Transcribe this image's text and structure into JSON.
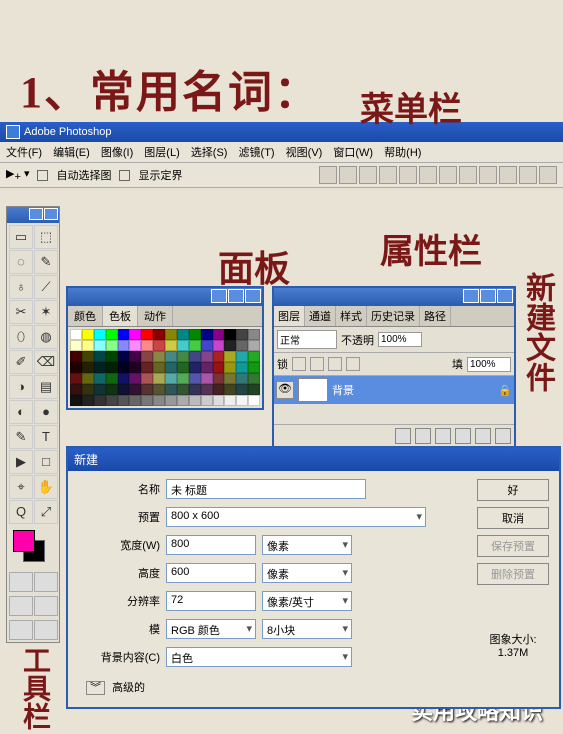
{
  "annotations": {
    "title": "1、常用名词：",
    "menubar": "菜单栏",
    "panel": "面板",
    "attrbar": "属性栏",
    "newfile": "新建文件",
    "toolbox": "工具栏",
    "watermark": "实用攻略知识"
  },
  "app": {
    "title": "Adobe Photoshop",
    "menu": {
      "file": "文件(F)",
      "edit": "编辑(E)",
      "image": "图像(I)",
      "layer": "图层(L)",
      "select": "选择(S)",
      "filter": "滤镜(T)",
      "view": "视图(V)",
      "window": "窗口(W)",
      "help": "帮助(H)"
    },
    "options": {
      "auto_select": "自动选择图",
      "show_bounds": "显示定界"
    }
  },
  "swatch_panel": {
    "tabs": {
      "color": "颜色",
      "swatches": "色板",
      "actions": "动作"
    }
  },
  "layers_panel": {
    "tabs": {
      "layers": "图层",
      "channels": "通道",
      "styles": "样式",
      "history": "历史记录",
      "paths": "路径"
    },
    "blend": "正常",
    "opacity_label": "不透明",
    "opacity": "100%",
    "lock_label": "锁",
    "fill_label": "填",
    "fill": "100%",
    "bg_layer": "背景"
  },
  "new_dialog": {
    "title": "新建",
    "name_label": "名称",
    "name": "未 标题",
    "preset_label": "预置",
    "preset": "800 x 600",
    "width_label": "宽度(W)",
    "width": "800",
    "width_unit": "像素",
    "height_label": "高度",
    "height": "600",
    "height_unit": "像素",
    "res_label": "分辨率",
    "res": "72",
    "res_unit": "像素/英寸",
    "mode_label": "模",
    "mode": "RGB 颜色",
    "depth": "8小块",
    "bg_label": "背景内容(C)",
    "bg": "白色",
    "advanced": "高级的",
    "ok": "好",
    "cancel": "取消",
    "save_preset": "保存预置",
    "del_preset": "删除预置",
    "size_label": "图象大小:",
    "size": "1.37M"
  },
  "tools": [
    "▭",
    "⬚",
    "◌",
    "✎",
    "♁",
    "⟋",
    "✂",
    "✶",
    "⬯",
    "◍",
    "✐",
    "⌫",
    "◑",
    "▤",
    "◐",
    "●",
    "✎",
    "T",
    "▶",
    "□",
    "⌖",
    "✋",
    "Q",
    "⤢"
  ],
  "swatch_colors": [
    "#fff",
    "#ff0",
    "#0ff",
    "#0f0",
    "#00f",
    "#f0f",
    "#f00",
    "#800",
    "#880",
    "#088",
    "#080",
    "#008",
    "#808",
    "#000",
    "#444",
    "#888",
    "#ffc",
    "#ff8",
    "#8ff",
    "#8f8",
    "#88f",
    "#f8f",
    "#f88",
    "#c44",
    "#cc4",
    "#4cc",
    "#4c4",
    "#44c",
    "#c4c",
    "#222",
    "#666",
    "#aaa",
    "#400",
    "#440",
    "#044",
    "#040",
    "#004",
    "#404",
    "#844",
    "#884",
    "#488",
    "#484",
    "#448",
    "#848",
    "#a22",
    "#aa2",
    "#2aa",
    "#2a2",
    "#200",
    "#220",
    "#022",
    "#020",
    "#002",
    "#202",
    "#622",
    "#662",
    "#266",
    "#262",
    "#226",
    "#626",
    "#911",
    "#991",
    "#199",
    "#191",
    "#611",
    "#661",
    "#166",
    "#161",
    "#116",
    "#616",
    "#a55",
    "#aa5",
    "#5aa",
    "#5a5",
    "#55a",
    "#a5a",
    "#733",
    "#773",
    "#377",
    "#373",
    "#311",
    "#331",
    "#133",
    "#131",
    "#113",
    "#313",
    "#533",
    "#553",
    "#355",
    "#353",
    "#335",
    "#535",
    "#422",
    "#442",
    "#244",
    "#242",
    "#111",
    "#222",
    "#333",
    "#444",
    "#555",
    "#666",
    "#777",
    "#888",
    "#999",
    "#aaa",
    "#bbb",
    "#ccc",
    "#ddd",
    "#eee",
    "#f5f5f5",
    "#fff"
  ]
}
